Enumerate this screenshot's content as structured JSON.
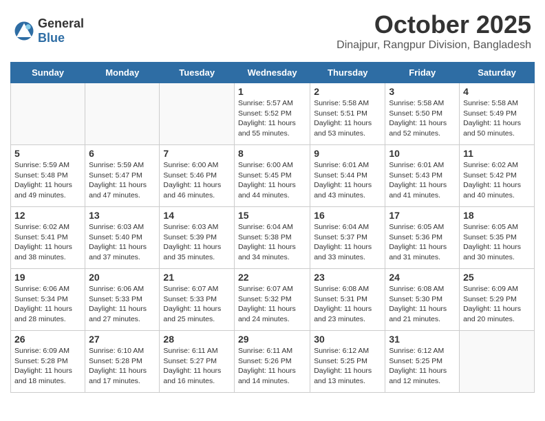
{
  "logo": {
    "general": "General",
    "blue": "Blue"
  },
  "header": {
    "month": "October 2025",
    "location": "Dinajpur, Rangpur Division, Bangladesh"
  },
  "weekdays": [
    "Sunday",
    "Monday",
    "Tuesday",
    "Wednesday",
    "Thursday",
    "Friday",
    "Saturday"
  ],
  "weeks": [
    [
      {
        "day": "",
        "sunrise": "",
        "sunset": "",
        "daylight": ""
      },
      {
        "day": "",
        "sunrise": "",
        "sunset": "",
        "daylight": ""
      },
      {
        "day": "",
        "sunrise": "",
        "sunset": "",
        "daylight": ""
      },
      {
        "day": "1",
        "sunrise": "Sunrise: 5:57 AM",
        "sunset": "Sunset: 5:52 PM",
        "daylight": "Daylight: 11 hours and 55 minutes."
      },
      {
        "day": "2",
        "sunrise": "Sunrise: 5:58 AM",
        "sunset": "Sunset: 5:51 PM",
        "daylight": "Daylight: 11 hours and 53 minutes."
      },
      {
        "day": "3",
        "sunrise": "Sunrise: 5:58 AM",
        "sunset": "Sunset: 5:50 PM",
        "daylight": "Daylight: 11 hours and 52 minutes."
      },
      {
        "day": "4",
        "sunrise": "Sunrise: 5:58 AM",
        "sunset": "Sunset: 5:49 PM",
        "daylight": "Daylight: 11 hours and 50 minutes."
      }
    ],
    [
      {
        "day": "5",
        "sunrise": "Sunrise: 5:59 AM",
        "sunset": "Sunset: 5:48 PM",
        "daylight": "Daylight: 11 hours and 49 minutes."
      },
      {
        "day": "6",
        "sunrise": "Sunrise: 5:59 AM",
        "sunset": "Sunset: 5:47 PM",
        "daylight": "Daylight: 11 hours and 47 minutes."
      },
      {
        "day": "7",
        "sunrise": "Sunrise: 6:00 AM",
        "sunset": "Sunset: 5:46 PM",
        "daylight": "Daylight: 11 hours and 46 minutes."
      },
      {
        "day": "8",
        "sunrise": "Sunrise: 6:00 AM",
        "sunset": "Sunset: 5:45 PM",
        "daylight": "Daylight: 11 hours and 44 minutes."
      },
      {
        "day": "9",
        "sunrise": "Sunrise: 6:01 AM",
        "sunset": "Sunset: 5:44 PM",
        "daylight": "Daylight: 11 hours and 43 minutes."
      },
      {
        "day": "10",
        "sunrise": "Sunrise: 6:01 AM",
        "sunset": "Sunset: 5:43 PM",
        "daylight": "Daylight: 11 hours and 41 minutes."
      },
      {
        "day": "11",
        "sunrise": "Sunrise: 6:02 AM",
        "sunset": "Sunset: 5:42 PM",
        "daylight": "Daylight: 11 hours and 40 minutes."
      }
    ],
    [
      {
        "day": "12",
        "sunrise": "Sunrise: 6:02 AM",
        "sunset": "Sunset: 5:41 PM",
        "daylight": "Daylight: 11 hours and 38 minutes."
      },
      {
        "day": "13",
        "sunrise": "Sunrise: 6:03 AM",
        "sunset": "Sunset: 5:40 PM",
        "daylight": "Daylight: 11 hours and 37 minutes."
      },
      {
        "day": "14",
        "sunrise": "Sunrise: 6:03 AM",
        "sunset": "Sunset: 5:39 PM",
        "daylight": "Daylight: 11 hours and 35 minutes."
      },
      {
        "day": "15",
        "sunrise": "Sunrise: 6:04 AM",
        "sunset": "Sunset: 5:38 PM",
        "daylight": "Daylight: 11 hours and 34 minutes."
      },
      {
        "day": "16",
        "sunrise": "Sunrise: 6:04 AM",
        "sunset": "Sunset: 5:37 PM",
        "daylight": "Daylight: 11 hours and 33 minutes."
      },
      {
        "day": "17",
        "sunrise": "Sunrise: 6:05 AM",
        "sunset": "Sunset: 5:36 PM",
        "daylight": "Daylight: 11 hours and 31 minutes."
      },
      {
        "day": "18",
        "sunrise": "Sunrise: 6:05 AM",
        "sunset": "Sunset: 5:35 PM",
        "daylight": "Daylight: 11 hours and 30 minutes."
      }
    ],
    [
      {
        "day": "19",
        "sunrise": "Sunrise: 6:06 AM",
        "sunset": "Sunset: 5:34 PM",
        "daylight": "Daylight: 11 hours and 28 minutes."
      },
      {
        "day": "20",
        "sunrise": "Sunrise: 6:06 AM",
        "sunset": "Sunset: 5:33 PM",
        "daylight": "Daylight: 11 hours and 27 minutes."
      },
      {
        "day": "21",
        "sunrise": "Sunrise: 6:07 AM",
        "sunset": "Sunset: 5:33 PM",
        "daylight": "Daylight: 11 hours and 25 minutes."
      },
      {
        "day": "22",
        "sunrise": "Sunrise: 6:07 AM",
        "sunset": "Sunset: 5:32 PM",
        "daylight": "Daylight: 11 hours and 24 minutes."
      },
      {
        "day": "23",
        "sunrise": "Sunrise: 6:08 AM",
        "sunset": "Sunset: 5:31 PM",
        "daylight": "Daylight: 11 hours and 23 minutes."
      },
      {
        "day": "24",
        "sunrise": "Sunrise: 6:08 AM",
        "sunset": "Sunset: 5:30 PM",
        "daylight": "Daylight: 11 hours and 21 minutes."
      },
      {
        "day": "25",
        "sunrise": "Sunrise: 6:09 AM",
        "sunset": "Sunset: 5:29 PM",
        "daylight": "Daylight: 11 hours and 20 minutes."
      }
    ],
    [
      {
        "day": "26",
        "sunrise": "Sunrise: 6:09 AM",
        "sunset": "Sunset: 5:28 PM",
        "daylight": "Daylight: 11 hours and 18 minutes."
      },
      {
        "day": "27",
        "sunrise": "Sunrise: 6:10 AM",
        "sunset": "Sunset: 5:28 PM",
        "daylight": "Daylight: 11 hours and 17 minutes."
      },
      {
        "day": "28",
        "sunrise": "Sunrise: 6:11 AM",
        "sunset": "Sunset: 5:27 PM",
        "daylight": "Daylight: 11 hours and 16 minutes."
      },
      {
        "day": "29",
        "sunrise": "Sunrise: 6:11 AM",
        "sunset": "Sunset: 5:26 PM",
        "daylight": "Daylight: 11 hours and 14 minutes."
      },
      {
        "day": "30",
        "sunrise": "Sunrise: 6:12 AM",
        "sunset": "Sunset: 5:25 PM",
        "daylight": "Daylight: 11 hours and 13 minutes."
      },
      {
        "day": "31",
        "sunrise": "Sunrise: 6:12 AM",
        "sunset": "Sunset: 5:25 PM",
        "daylight": "Daylight: 11 hours and 12 minutes."
      },
      {
        "day": "",
        "sunrise": "",
        "sunset": "",
        "daylight": ""
      }
    ]
  ]
}
